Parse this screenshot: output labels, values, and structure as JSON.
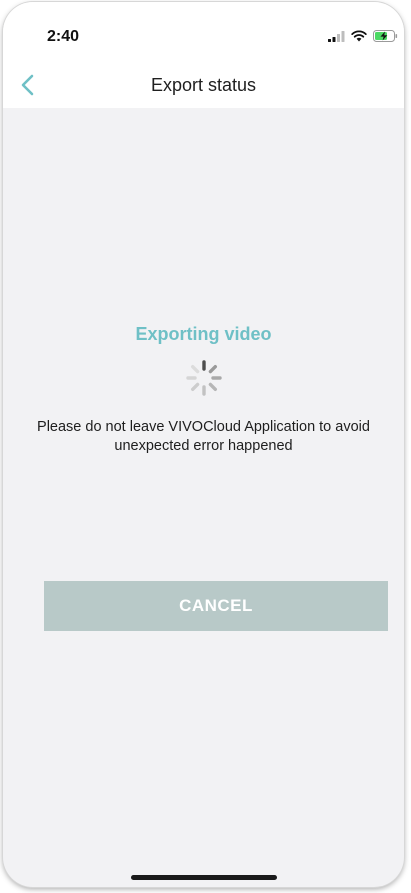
{
  "status_bar": {
    "time": "2:40",
    "icons": [
      "cellular-signal-icon",
      "wifi-icon",
      "battery-charging-icon"
    ]
  },
  "nav": {
    "back_icon": "chevron-left-icon",
    "title": "Export status"
  },
  "main": {
    "export_title": "Exporting video",
    "warning": "Please do not leave VIVOCloud Application to avoid unexpected error happened",
    "cancel_label": "CANCEL"
  },
  "colors": {
    "accent": "#6fc0c6",
    "button_bg": "#b8c9c8",
    "background": "#f2f2f4"
  }
}
